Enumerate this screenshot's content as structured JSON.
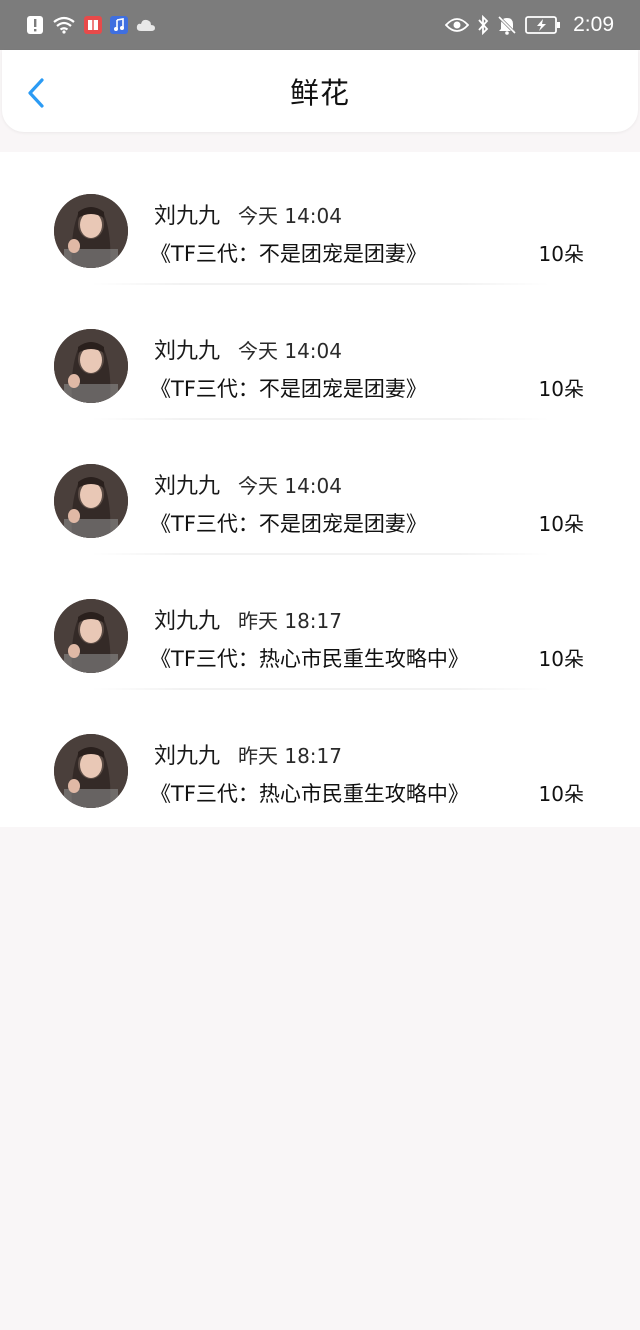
{
  "status_bar": {
    "time": "2:09",
    "icons_left": [
      "alert-icon",
      "wifi-icon",
      "book-app-icon",
      "music-app-icon",
      "cloud-icon"
    ],
    "icons_right": [
      "eye-icon",
      "bluetooth-icon",
      "mute-bell-icon",
      "battery-charging-icon"
    ]
  },
  "header": {
    "title": "鲜花",
    "back_icon": "chevron-left-icon"
  },
  "colors": {
    "status_bar_bg": "#7c7c7c",
    "accent": "#2b9bf4",
    "page_bg": "#f9f6f7"
  },
  "records": [
    {
      "name": "刘九九",
      "time": "今天 14:04",
      "book": "《TF三代：不是团宠是团妻》",
      "count": "10朵"
    },
    {
      "name": "刘九九",
      "time": "今天 14:04",
      "book": "《TF三代：不是团宠是团妻》",
      "count": "10朵"
    },
    {
      "name": "刘九九",
      "time": "今天 14:04",
      "book": "《TF三代：不是团宠是团妻》",
      "count": "10朵"
    },
    {
      "name": "刘九九",
      "time": "昨天 18:17",
      "book": "《TF三代：热心市民重生攻略中》",
      "count": "10朵"
    },
    {
      "name": "刘九九",
      "time": "昨天 18:17",
      "book": "《TF三代：热心市民重生攻略中》",
      "count": "10朵"
    }
  ]
}
